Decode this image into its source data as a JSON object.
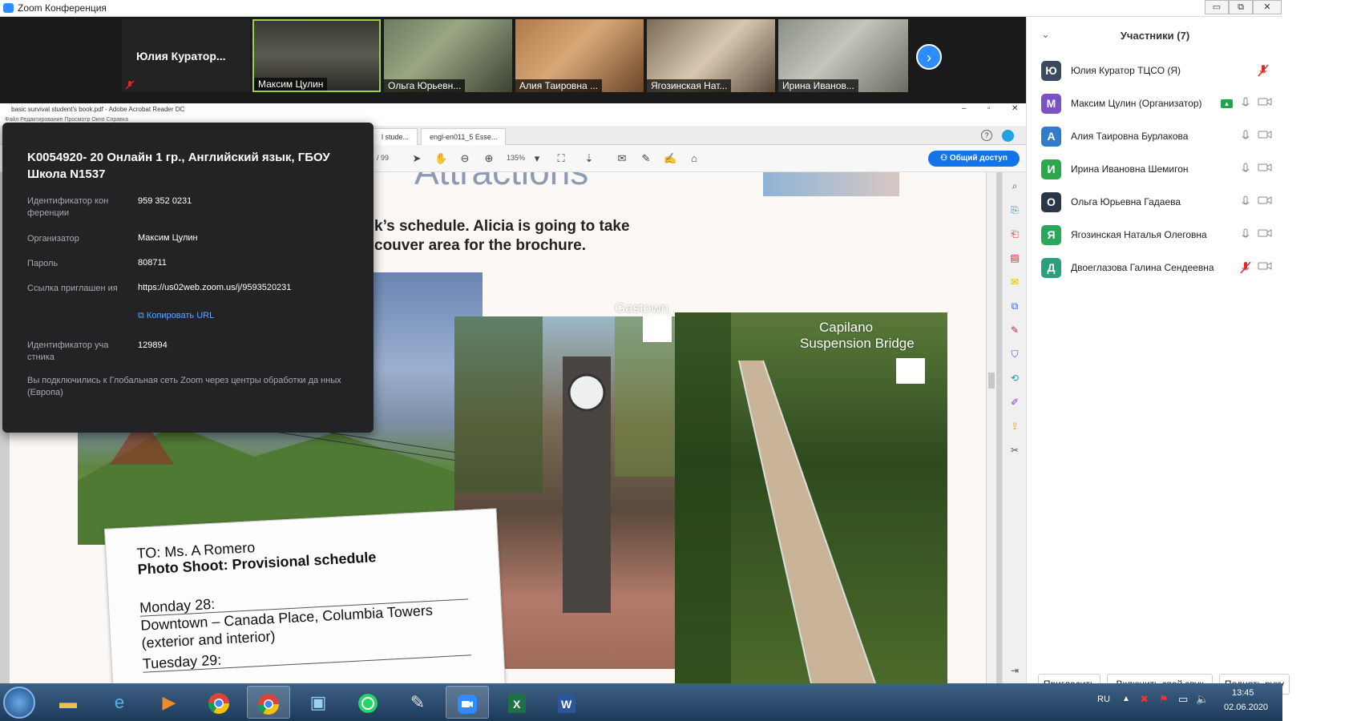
{
  "window": {
    "title": "Zoom Конференция",
    "min": "▭",
    "max": "⧉",
    "close": "✕"
  },
  "video_strip": {
    "self_name": "Юлия  Куратор...",
    "tiles": [
      {
        "name": "Максим Цулин"
      },
      {
        "name": "Ольга Юрьевн..."
      },
      {
        "name": "Алия Таировна ..."
      },
      {
        "name": "Ягозинская Нат..."
      },
      {
        "name": "Ирина Иванов..."
      }
    ],
    "next_icon": "chevron-right-icon"
  },
  "acrobat": {
    "title": "basic survival student's book.pdf - Adobe Acrobat Reader DC",
    "menu": "Файл   Редактирование   Просмотр   Окно   Справка",
    "tabs": [
      "l stude...",
      "engl-en011_5 Esse..."
    ],
    "page_total": "/ 99",
    "zoom": "135%",
    "share_label": "Общий доступ",
    "page": {
      "heading": "Attractions",
      "line1": "k’s schedule. Alicia is going to take",
      "line2": "couver area for the brochure.",
      "label_gastown": "Gastown",
      "label_capilano_1": "Capilano",
      "label_capilano_2": "Suspension Bridge",
      "note": {
        "to": "TO: Ms. A Romero",
        "subject": "Photo Shoot: Provisional schedule",
        "day1": "Monday 28:",
        "item1": "Downtown – Canada Place, Columbia Towers",
        "item1b": "(exterior and interior)",
        "day2": "Tuesday 29:"
      }
    }
  },
  "meeting_info": {
    "title": "K0054920- 20 Онлайн 1 гр., Английский язык, ГБОУ Школа N1537",
    "conf_id_label": "Идентификатор кон ференции",
    "conf_id": "959 352 0231",
    "host_label": "Организатор",
    "host": "Максим Цулин",
    "password_label": "Пароль",
    "password": "808711",
    "invite_label": "Ссылка приглашен ия",
    "invite_link": "https://us02web.zoom.us/j/9593520231",
    "copy_url": "Копировать URL",
    "participant_id_label": "Идентификатор уча стника",
    "participant_id": "129894",
    "footer": "Вы подключились к Глобальная сеть Zoom через центры обработки да нных (Европа)"
  },
  "participants": {
    "header": "Участники (7)",
    "list": [
      {
        "initial": "Ю",
        "name": "Юлия Куратор ТЦСО (Я)",
        "color": "#3b4a5e",
        "mic": "muted"
      },
      {
        "initial": "М",
        "name": "Максим Цулин (Организатор)",
        "color": "#7b52c6",
        "mic": "on"
      },
      {
        "initial": "А",
        "name": "Алия Таировна Бурлакова",
        "color": "#2f7cc8",
        "mic": "on"
      },
      {
        "initial": "И",
        "name": "Ирина Ивановна Шемигон",
        "color": "#2aa84a",
        "mic": "on"
      },
      {
        "initial": "О",
        "name": "Ольга Юрьевна Гадаева",
        "color": "#2b3748",
        "mic": "on"
      },
      {
        "initial": "Я",
        "name": "Ягозинская Наталья Олеговна",
        "color": "#28a85a",
        "mic": "on"
      },
      {
        "initial": "Д",
        "name": "Двоеглазова Галина Сендеевна",
        "color": "#29a07a",
        "mic": "muted"
      }
    ],
    "buttons": {
      "invite": "Пригласить",
      "unmute": "Включить свой звук",
      "raise_hand": "Поднять руку"
    }
  },
  "taskbar": {
    "lang": "RU",
    "time": "13:45",
    "date": "02.06.2020"
  }
}
